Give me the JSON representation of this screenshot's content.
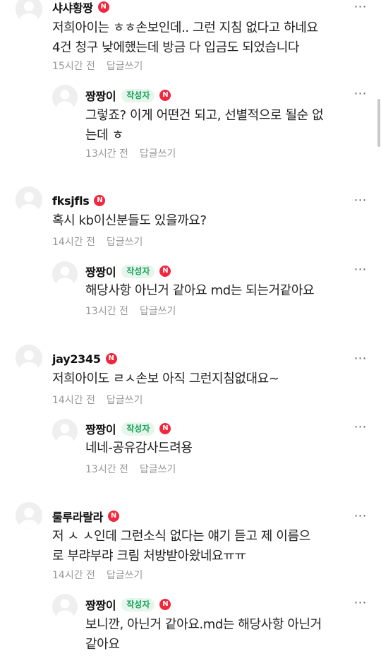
{
  "comments": [
    {
      "nickname": "샤샤황짱",
      "badge_n": "N",
      "text": "저희아이는 ㅎㅎ손보인데.. 그런 지침 없다고 하네요\n4건 청구 낮에했는데 방금 다 입금도 되었습니다",
      "time": "15시간 전",
      "reply_label": "답글쓰기",
      "reply": {
        "nickname": "짱짱이",
        "author_label": "작성자",
        "badge_n": "N",
        "text": "그렇죠? 이게 어떤건 되고, 선별적으로 될순 없\n는데 ㅎ",
        "time": "13시간 전",
        "reply_label": "답글쓰기"
      }
    },
    {
      "nickname": "fksjfls",
      "badge_n": "N",
      "text": "혹시 kb이신분들도 있을까요?",
      "time": "14시간 전",
      "reply_label": "답글쓰기",
      "reply": {
        "nickname": "짱짱이",
        "author_label": "작성자",
        "badge_n": "N",
        "text": "해당사항 아닌거 같아요 md는 되는거같아요",
        "time": "13시간 전",
        "reply_label": "답글쓰기"
      }
    },
    {
      "nickname": "jay2345",
      "badge_n": "N",
      "text": "저희아이도 ㄹㅅ손보 아직 그런지침없대요~",
      "time": "14시간 전",
      "reply_label": "답글쓰기",
      "reply": {
        "nickname": "짱짱이",
        "author_label": "작성자",
        "badge_n": "N",
        "text": "네네-공유감사드려용",
        "time": "13시간 전",
        "reply_label": "답글쓰기"
      }
    },
    {
      "nickname": "룰루라랄라",
      "badge_n": "N",
      "text": "저 ㅅ ㅅ인데 그런소식 없다는 얘기 듣고 제 이름으\n로 부랴부랴 크림 처방받아왔네요ㅠㅠ",
      "time": "14시간 전",
      "reply_label": "답글쓰기",
      "reply": {
        "nickname": "짱짱이",
        "author_label": "작성자",
        "badge_n": "N",
        "text": "보니깐, 아닌거 같아요.md는 해당사항 아닌거\n같아요"
      }
    }
  ],
  "icons": {
    "more": "more-dots-icon",
    "avatar": "default-avatar-icon"
  },
  "colors": {
    "n_badge": "#f2273d",
    "author_badge_text": "#1aa35a",
    "author_badge_bg": "#e6f6ec",
    "meta_text": "#999999"
  }
}
